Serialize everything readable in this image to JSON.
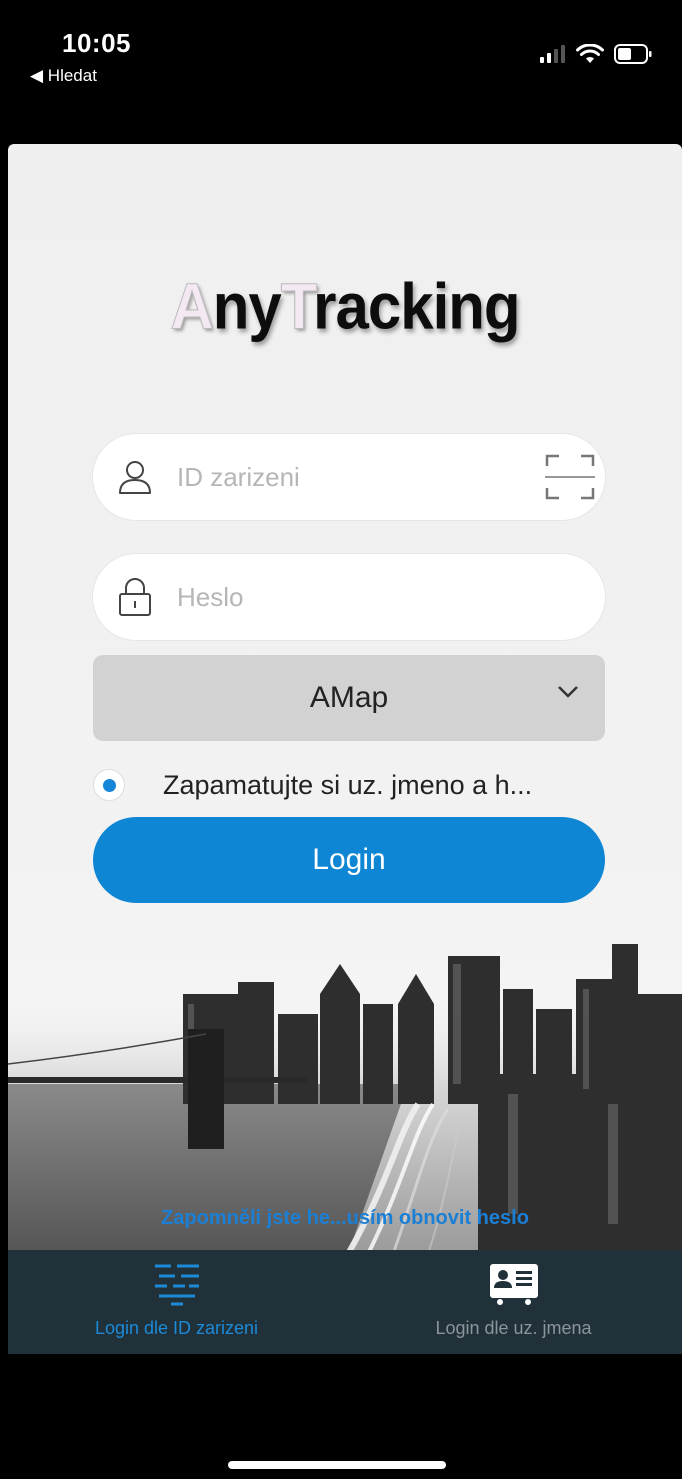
{
  "status_bar": {
    "time": "10:05",
    "back_label": "◀ Hledat"
  },
  "app": {
    "logo": {
      "part1_initial": "A",
      "part1_rest": "ny",
      "part2_initial": "T",
      "part2_rest": "racking"
    },
    "device_id_field": {
      "placeholder": "ID zarizeni",
      "icon": "user-icon",
      "action_icon": "scan-icon"
    },
    "password_field": {
      "placeholder": "Heslo",
      "icon": "lock-icon"
    },
    "map_select": {
      "value": "AMap",
      "icon": "chevron-down-icon"
    },
    "remember": {
      "checked": true,
      "label": "Zapamatujte si uz. jmeno a h..."
    },
    "login_button": {
      "label": "Login"
    },
    "forgot_link": "Zapomněli jste he...usím obnovit heslo",
    "tabs": [
      {
        "label": "Login dle ID zarizeni",
        "icon": "device-id-icon",
        "active": true
      },
      {
        "label": "Login dle uz. jmena",
        "icon": "user-card-icon",
        "active": false
      }
    ]
  },
  "colors": {
    "accent": "#0f86d3",
    "tab_bar": "#213139",
    "tab_active": "#1c8ad8",
    "tab_inactive": "#8b959a"
  }
}
